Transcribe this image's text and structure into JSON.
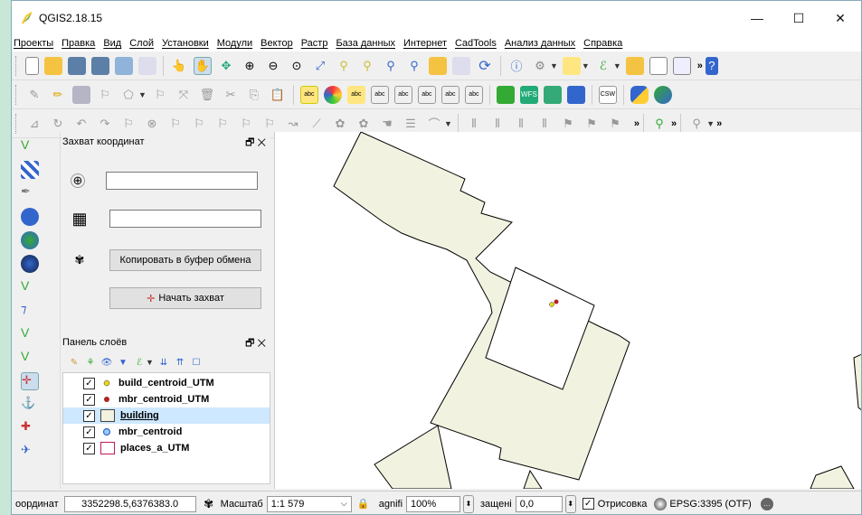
{
  "window": {
    "title": "QGIS2.18.15"
  },
  "menu": [
    "Проекты",
    "Правка",
    "Вид",
    "Слой",
    "Установки",
    "Модули",
    "Вектор",
    "Растр",
    "База данных",
    "Интернет",
    "CadTools",
    "Анализ данных",
    "Справка"
  ],
  "capture_panel": {
    "title": "Захват координат",
    "copy_button": "Копировать в буфер обмена",
    "start_button": "Начать захват"
  },
  "layers_panel": {
    "title": "Панель слоёв",
    "layers": [
      {
        "name": "build_centroid_UTM",
        "checked": "✓"
      },
      {
        "name": "mbr_centroid_UTM",
        "checked": "✓"
      },
      {
        "name": "building",
        "checked": "✓"
      },
      {
        "name": "mbr_centroid",
        "checked": "✓"
      },
      {
        "name": "places_a_UTM",
        "checked": "✓"
      }
    ]
  },
  "toolbar": {
    "csw_label": "CSW"
  },
  "statusbar": {
    "coord_label": "оординат",
    "coord_value": "3352298.5,6376383.0",
    "scale_label": "Масштаб",
    "scale_value": "1:1 579",
    "magnify_label": "agnifi",
    "magnify_value": "100%",
    "rotation_label": "защені",
    "rotation_value": "0,0",
    "render_label": "Отрисовка",
    "crs_value": "EPSG:3395 (OTF)"
  },
  "colors": {
    "building_fill": "#f2f2e0",
    "point_yellow": "#e8d81a",
    "point_red": "#b22222",
    "selection": "#cde8ff"
  }
}
